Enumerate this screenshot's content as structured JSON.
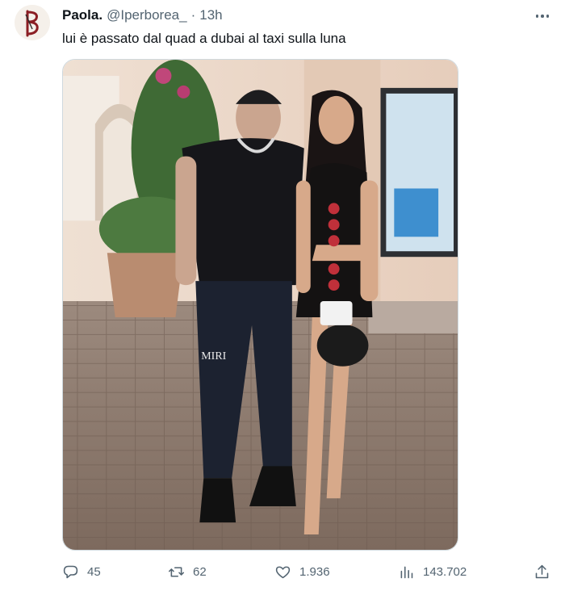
{
  "tweet": {
    "display_name": "Paola.",
    "handle": "@Iperborea_",
    "separator": "·",
    "timestamp": "13h",
    "text": "lui è passato dal quad a dubai al taxi sulla luna",
    "more_icon": "more-horizontal-icon",
    "media": {
      "icon": "photo",
      "brand_text_on_jeans": "MIRI"
    }
  },
  "actions": {
    "replies": "45",
    "retweets": "62",
    "likes": "1.936",
    "views": "143.702",
    "icons": [
      "reply-icon",
      "retweet-icon",
      "like-icon",
      "views-icon",
      "share-icon"
    ]
  }
}
